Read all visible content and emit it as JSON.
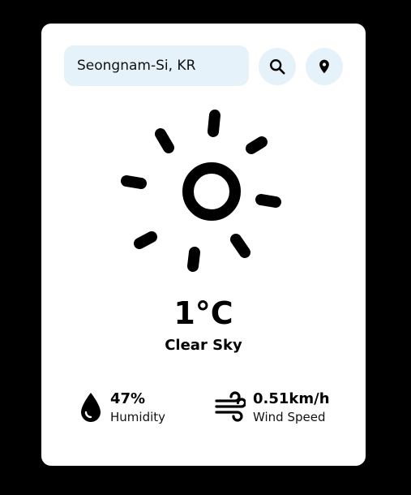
{
  "search": {
    "value": "Seongnam-Si, KR",
    "button_icon": "search-icon",
    "location_icon": "location-pin-icon"
  },
  "weather": {
    "icon": "sun-icon",
    "temperature": "1°C",
    "condition": "Clear Sky"
  },
  "stats": {
    "humidity": {
      "icon": "water-drop-icon",
      "value": "47%",
      "label": "Humidity"
    },
    "wind": {
      "icon": "wind-icon",
      "value": "0.51km/h",
      "label": "Wind Speed"
    }
  },
  "colors": {
    "background": "#000000",
    "card": "#ffffff",
    "input_background": "#e6f2fa",
    "icon": "#000000"
  }
}
